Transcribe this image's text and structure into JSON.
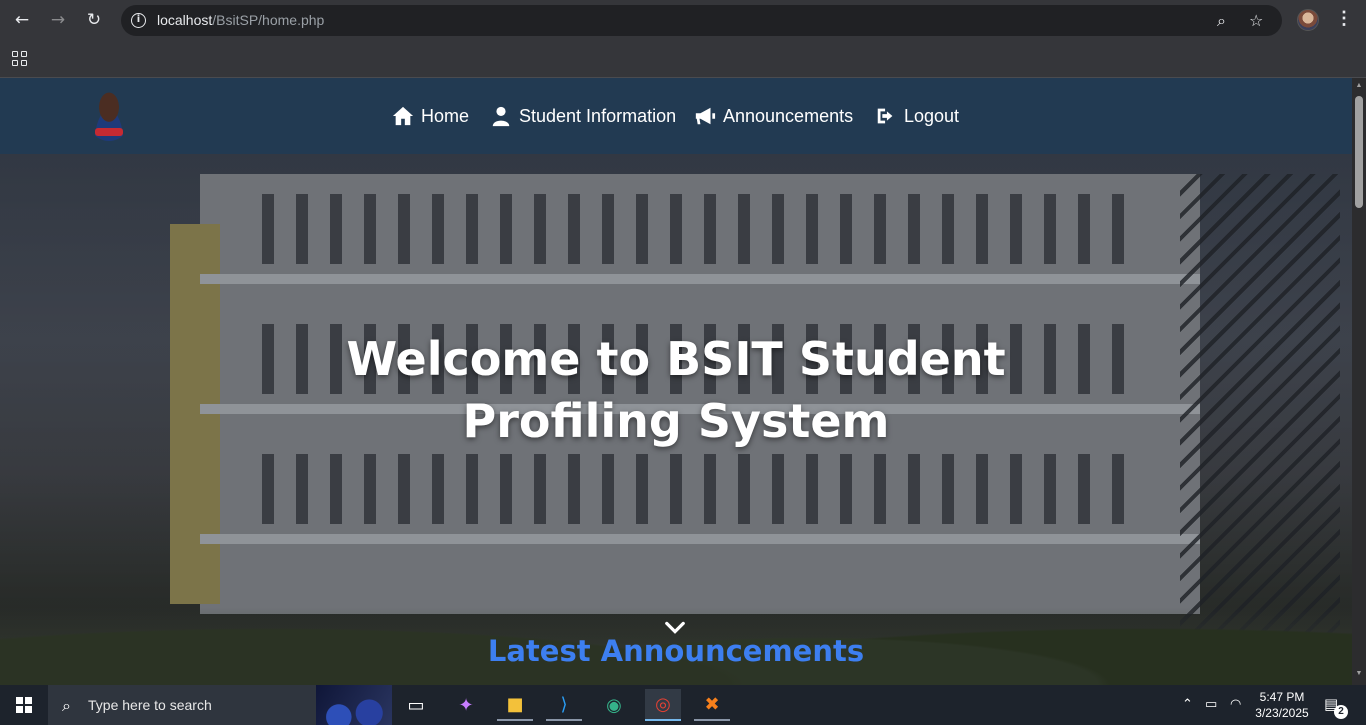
{
  "browser": {
    "url_host": "localhost",
    "url_path": "/BsitSP/home.php",
    "icons": [
      "back-arrow-icon",
      "forward-arrow-icon",
      "reload-icon",
      "site-info-icon",
      "zoom-icon",
      "bookmark-star-icon",
      "profile-avatar",
      "menu-dots-icon",
      "apps-grid-icon"
    ]
  },
  "site": {
    "nav": [
      {
        "label": "Home",
        "icon": "home-icon"
      },
      {
        "label": "Student Information",
        "icon": "user-icon"
      },
      {
        "label": "Announcements",
        "icon": "megaphone-icon"
      },
      {
        "label": "Logout",
        "icon": "logout-icon"
      }
    ],
    "hero_title": "Welcome to BSIT Student Profiling System",
    "latest_heading": "Latest Announcements",
    "colors": {
      "nav_bg": "#223a52",
      "accent": "#3d7ff0"
    }
  },
  "taskbar": {
    "search_placeholder": "Type here to search",
    "time": "5:47 PM",
    "date": "3/23/2025",
    "notification_count": "2"
  }
}
